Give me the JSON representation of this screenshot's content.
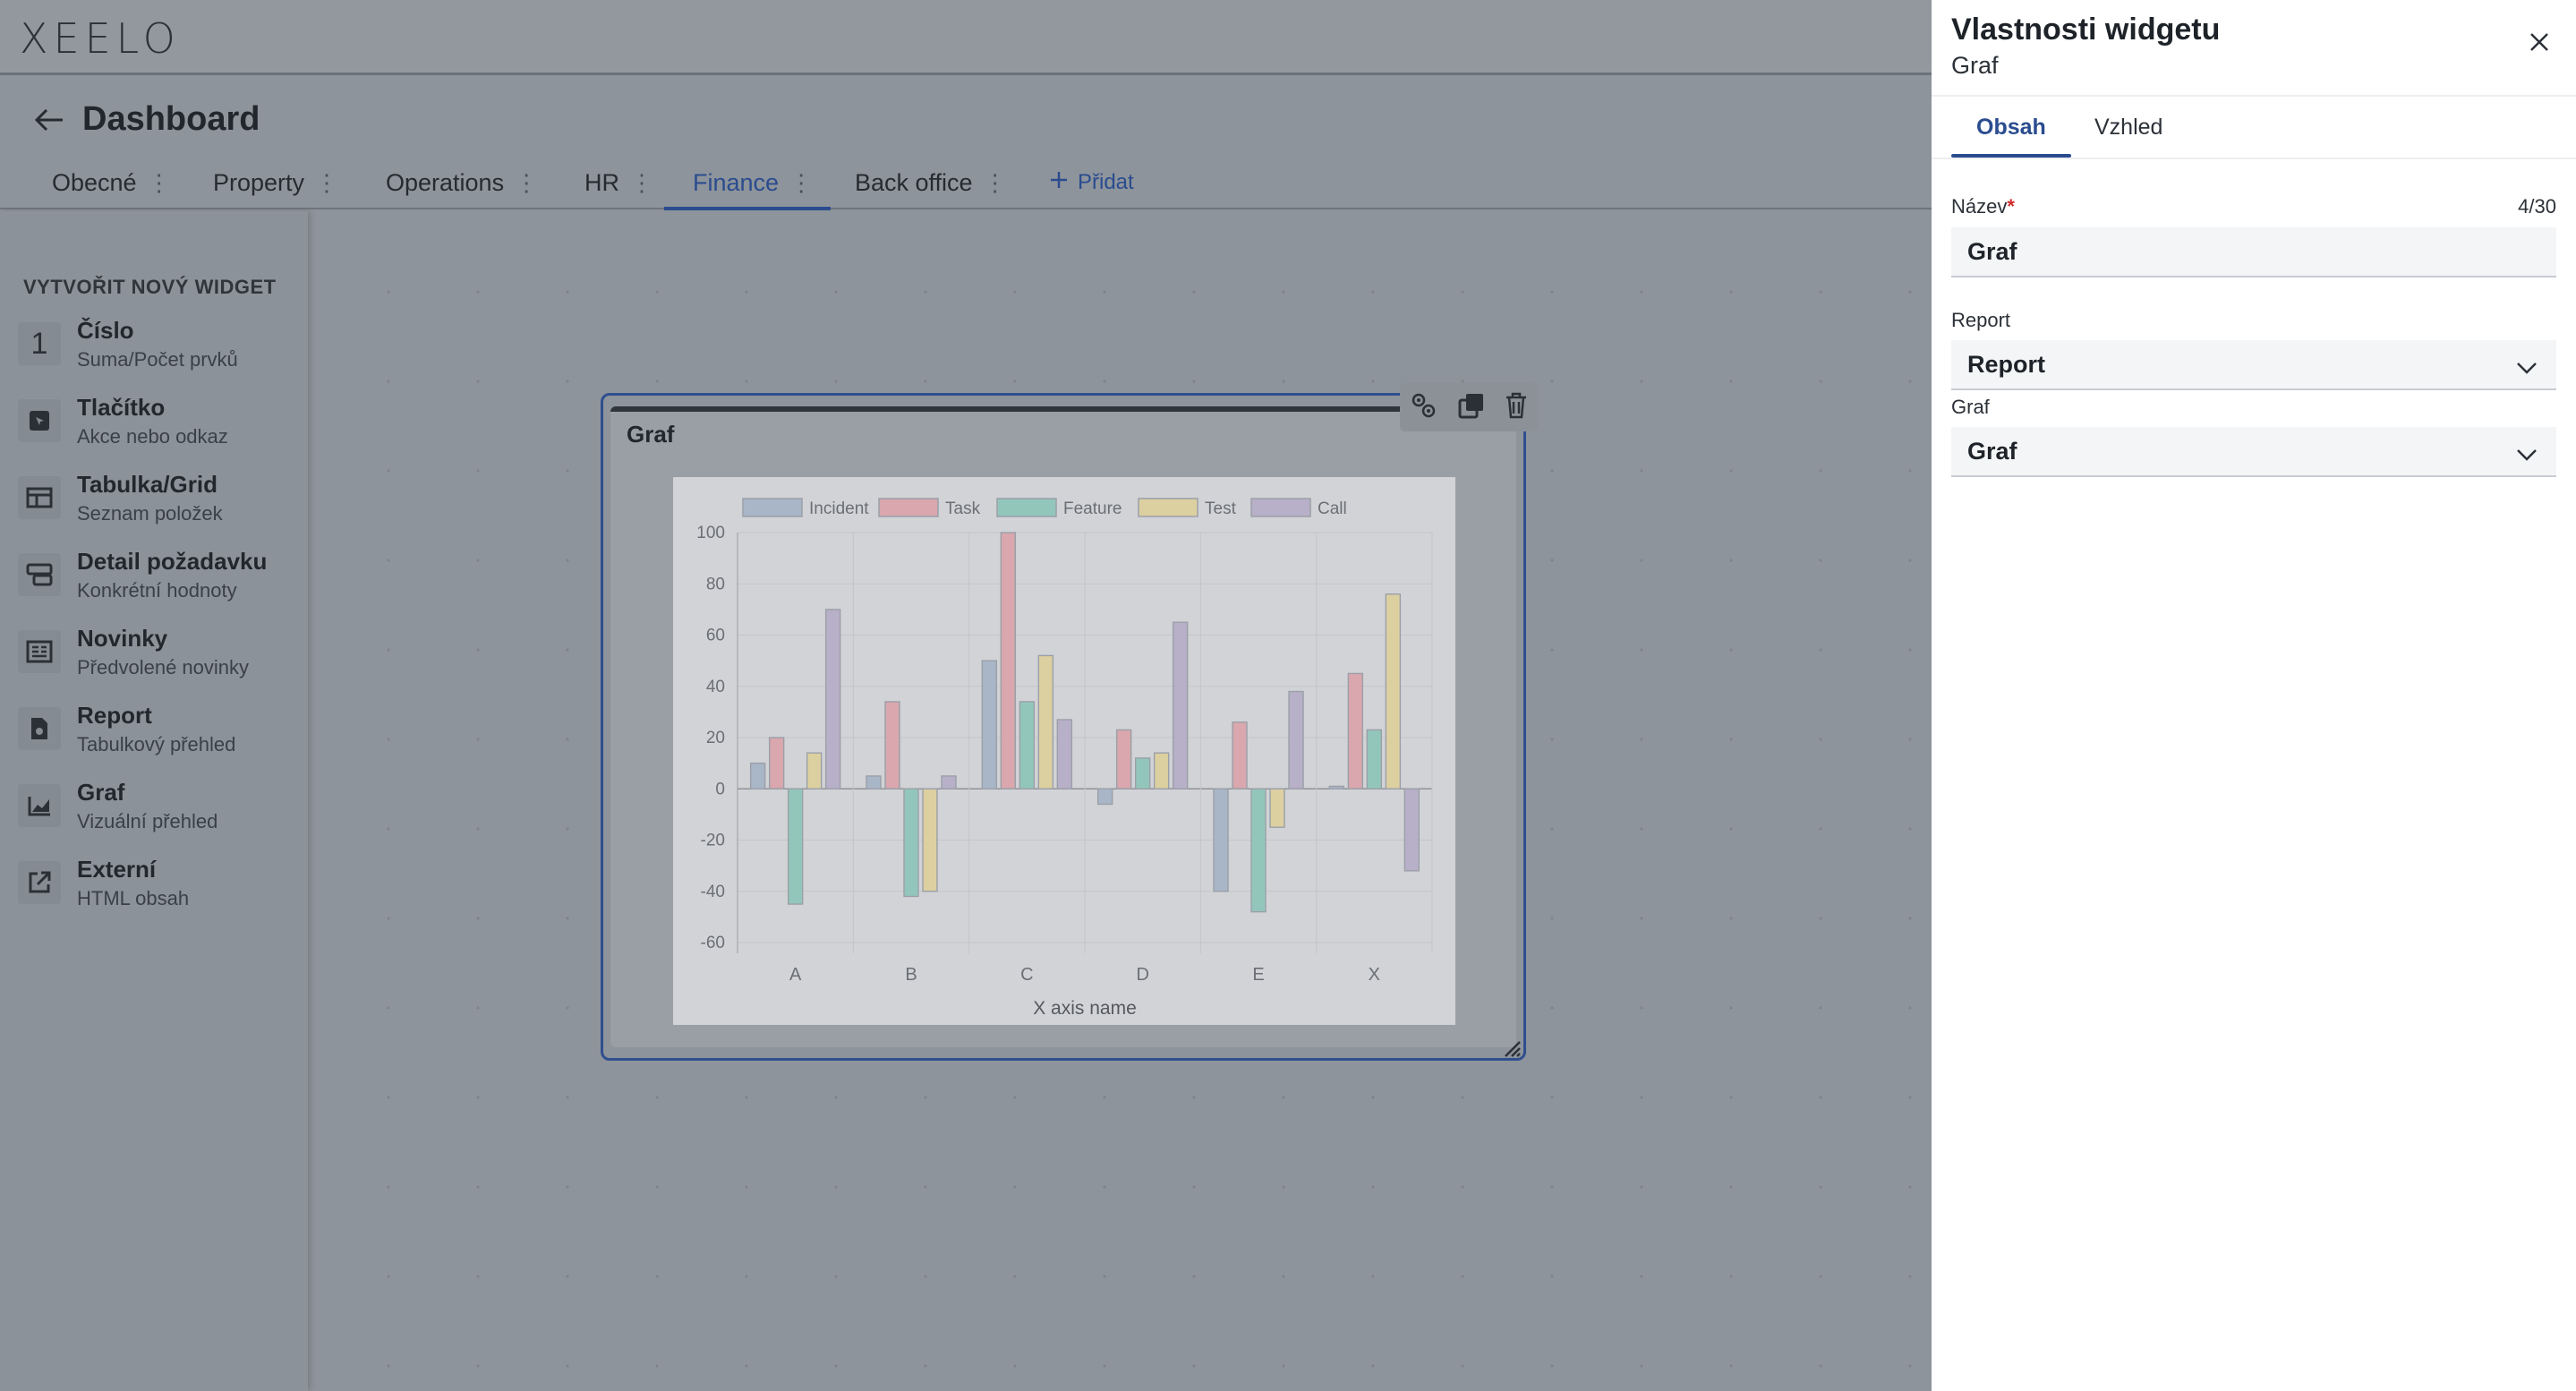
{
  "logo": "XEELO",
  "page": {
    "title": "Dashboard"
  },
  "tabs": [
    {
      "label": "Obecné"
    },
    {
      "label": "Property"
    },
    {
      "label": "Operations"
    },
    {
      "label": "HR"
    },
    {
      "label": "Finance"
    },
    {
      "label": "Back office"
    }
  ],
  "add_tab_label": "Přidat",
  "sidebar": {
    "heading": "VYTVOŘIT NOVÝ WIDGET",
    "items": [
      {
        "label": "Číslo",
        "desc": "Suma/Počet prvků",
        "icon": "number-icon"
      },
      {
        "label": "Tlačítko",
        "desc": "Akce nebo odkaz",
        "icon": "button-icon"
      },
      {
        "label": "Tabulka/Grid",
        "desc": "Seznam položek",
        "icon": "table-icon"
      },
      {
        "label": "Detail požadavku",
        "desc": "Konkrétní hodnoty",
        "icon": "detail-icon"
      },
      {
        "label": "Novinky",
        "desc": "Předvolené novinky",
        "icon": "news-icon"
      },
      {
        "label": "Report",
        "desc": "Tabulkový přehled",
        "icon": "report-icon"
      },
      {
        "label": "Graf",
        "desc": "Vizuální přehled",
        "icon": "chart-icon"
      },
      {
        "label": "Externí",
        "desc": "HTML obsah",
        "icon": "external-link-icon"
      }
    ],
    "number_glyph": "1"
  },
  "widget": {
    "title": "Graf"
  },
  "chart_data": {
    "type": "bar",
    "categories": [
      "A",
      "B",
      "C",
      "D",
      "E",
      "X"
    ],
    "xlabel": "X axis name",
    "ylim": [
      -60,
      100
    ],
    "yticks": [
      100,
      80,
      60,
      40,
      20,
      0,
      -20,
      -40,
      -60
    ],
    "legend_position": "top",
    "series": [
      {
        "name": "Incident",
        "color": "#a9b6c8",
        "values": [
          10,
          5,
          50,
          -6,
          -40,
          1
        ]
      },
      {
        "name": "Task",
        "color": "#d9a7ad",
        "values": [
          20,
          34,
          100,
          23,
          26,
          45
        ]
      },
      {
        "name": "Feature",
        "color": "#93c6bb",
        "values": [
          -45,
          -42,
          34,
          12,
          -48,
          23
        ]
      },
      {
        "name": "Test",
        "color": "#ddd0a0",
        "values": [
          14,
          -40,
          52,
          14,
          -15,
          76
        ]
      },
      {
        "name": "Call",
        "color": "#b8afc8",
        "values": [
          70,
          5,
          27,
          65,
          38,
          -32
        ]
      }
    ]
  },
  "panel": {
    "title": "Vlastnosti widgetu",
    "subtitle": "Graf",
    "tabs": [
      "Obsah",
      "Vzhled"
    ],
    "name_label": "Název",
    "required_mark": "*",
    "counter": "4/30",
    "name_value": "Graf",
    "report_label": "Report",
    "report_value": "Report",
    "graph_label": "Graf",
    "graph_value": "Graf"
  },
  "colors": {
    "accent": "#2a4c8f",
    "required": "#d02b2b",
    "overlay": "#8e949b"
  }
}
